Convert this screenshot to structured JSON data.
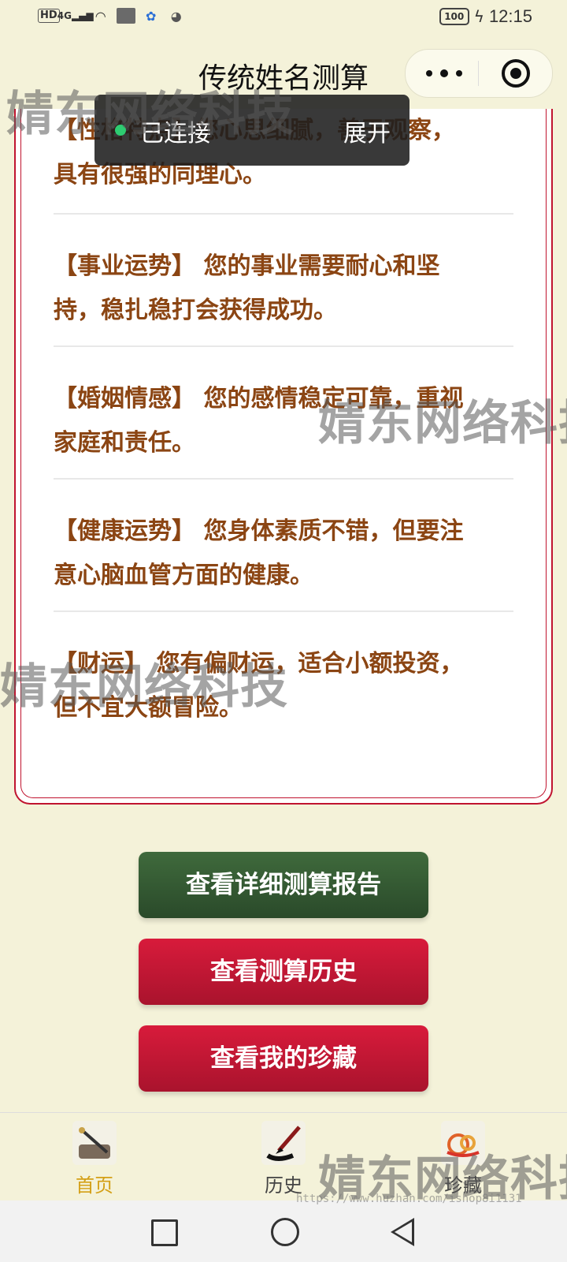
{
  "status_bar": {
    "hd": "HD",
    "network": "4G",
    "battery": "100",
    "time": "12:15",
    "icons": [
      "signal-icon",
      "wifi-icon",
      "app-thumbnail-icon",
      "baidu-icon",
      "wechat-icon",
      "charging-icon"
    ]
  },
  "nav": {
    "title": "传统姓名测算"
  },
  "toast": {
    "status": "已连接",
    "expand": "展开"
  },
  "results": [
    {
      "line1": "【性格特点】您心思细腻，善于观察，",
      "line2": "具有很强的同理心。"
    },
    {
      "line1": "【事业运势】 您的事业需要耐心和坚",
      "line2": "持，稳扎稳打会获得成功。"
    },
    {
      "line1": "【婚姻情感】 您的感情稳定可靠，重视",
      "line2": "家庭和责任。"
    },
    {
      "line1": "【健康运势】 您身体素质不错，但要注",
      "line2": "意心脑血管方面的健康。"
    },
    {
      "line1": "【财运】 您有偏财运，适合小额投资，",
      "line2": "但不宜大额冒险。"
    }
  ],
  "buttons": {
    "detail": "查看详细测算报告",
    "history": "查看测算历史",
    "favorites": "查看我的珍藏"
  },
  "tabbar": {
    "home": "首页",
    "history": "历史",
    "favorites": "珍藏",
    "active": "home"
  },
  "watermark": {
    "text": "婧东网络科技",
    "url": "https://www.huzhan.com/ishop8i1131"
  },
  "colors": {
    "accent_red": "#c0142f",
    "button_green": "#2f4f2f",
    "text_brown": "#8b4513",
    "background": "#f4f2d9",
    "tab_active": "#d4a017"
  }
}
